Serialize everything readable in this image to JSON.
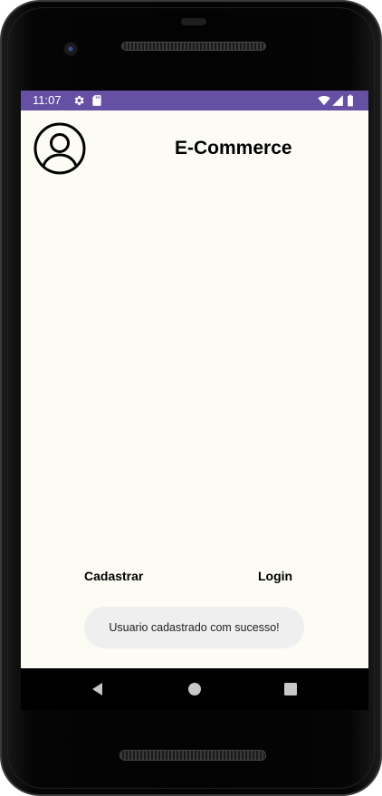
{
  "status_bar": {
    "time": "11:07",
    "background": "#6650a4",
    "icons": [
      "settings-icon",
      "sd-card-icon",
      "wifi-icon",
      "signal-icon",
      "battery-icon"
    ]
  },
  "header": {
    "title": "E-Commerce",
    "avatar_icon": "account-circle-icon"
  },
  "actions": {
    "register_label": "Cadastrar",
    "login_label": "Login"
  },
  "toast": {
    "message": "Usuario cadastrado com sucesso!"
  },
  "nav_bar": {
    "icons": [
      "back-icon",
      "home-icon",
      "recents-icon"
    ]
  },
  "colors": {
    "screen_background": "#fcfbf4",
    "accent": "#6650a4",
    "toast_background": "#efefef"
  }
}
